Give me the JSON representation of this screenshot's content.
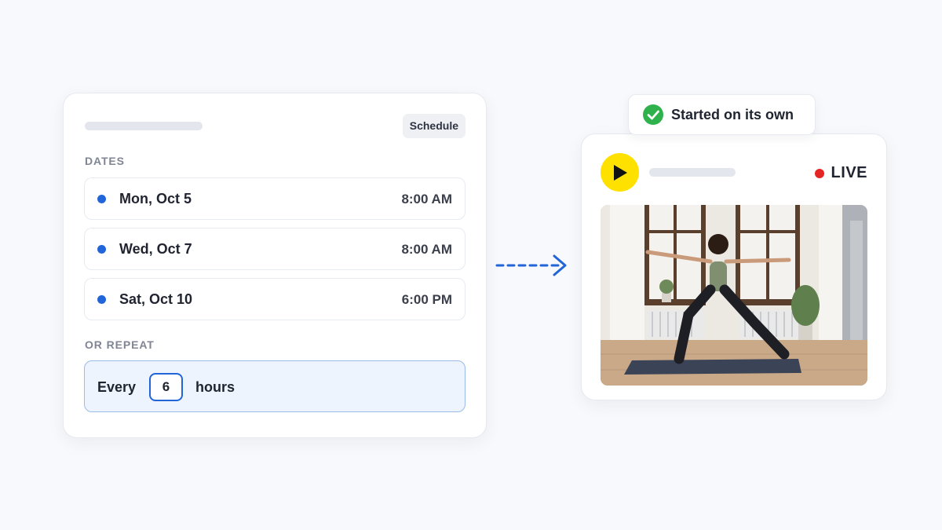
{
  "schedule": {
    "badge": "Schedule",
    "dates_label": "DATES",
    "dates": [
      {
        "day": "Mon, Oct 5",
        "time": "8:00 AM"
      },
      {
        "day": "Wed, Oct 7",
        "time": "8:00 AM"
      },
      {
        "day": "Sat, Oct 10",
        "time": "6:00 PM"
      }
    ],
    "repeat_label": "OR REPEAT",
    "repeat": {
      "prefix": "Every",
      "value": "6",
      "unit": "hours"
    }
  },
  "status": {
    "text": "Started on its own",
    "icon": "check-circle-icon",
    "color": "#2fb24c"
  },
  "live": {
    "badge": "LIVE",
    "badge_color": "#e52424",
    "play_icon": "play-icon",
    "play_color": "#ffe100"
  },
  "colors": {
    "accent": "#2165d9",
    "background": "#f8f9fc"
  }
}
